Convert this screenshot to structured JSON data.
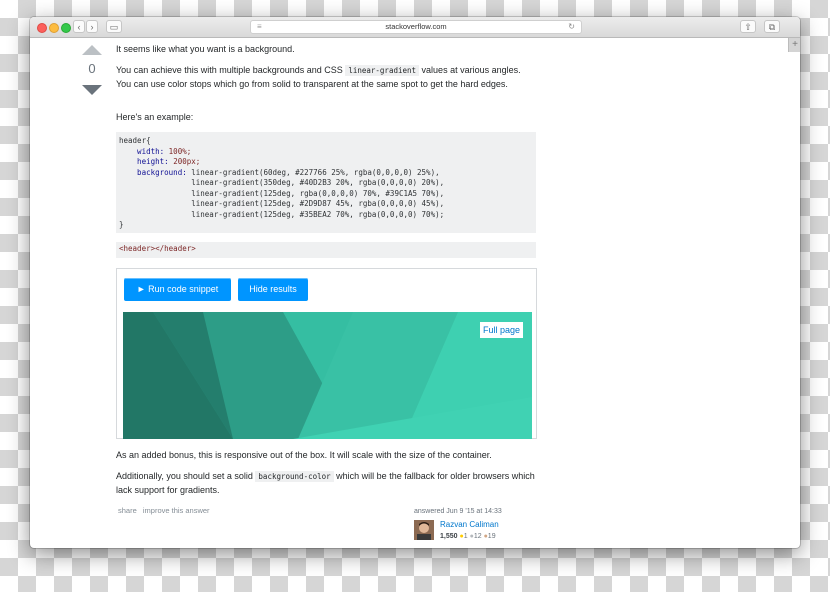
{
  "browser": {
    "url": "stackoverflow.com",
    "back_icon": "‹",
    "forward_icon": "›",
    "sidebar_icon": "▭",
    "lines_icon": "≡",
    "reload_icon": "↻",
    "share_icon": "⇧",
    "tabs_icon": "⧉",
    "new_tab_icon": "+"
  },
  "vote": {
    "score": "0"
  },
  "answer": {
    "p1": "It seems like what you want is a background.",
    "p2_before": "You can achieve this with multiple backgrounds and CSS ",
    "p2_code": "linear-gradient",
    "p2_after": " values at various angles. You can use color stops which go from solid to transparent at the same spot to get the hard edges.",
    "p3": "Here's an example:",
    "code_lines": [
      {
        "a": "header{",
        "b": ""
      },
      {
        "a": "    width: ",
        "b": "100%;",
        "kw": true
      },
      {
        "a": "    height: ",
        "b": "200px;",
        "kw": true
      },
      {
        "a": "    background: ",
        "b": "linear-gradient(60deg, #227766 25%, rgba(0,0,0,0) 25%),",
        "kw": true
      },
      {
        "a": "                ",
        "b": "linear-gradient(350deg, #40D2B3 20%, rgba(0,0,0,0) 20%),"
      },
      {
        "a": "                ",
        "b": "linear-gradient(125deg, rgba(0,0,0,0) 70%, #39C1A5 70%),"
      },
      {
        "a": "                ",
        "b": "linear-gradient(125deg, #2D9D87 45%, rgba(0,0,0,0) 45%),"
      },
      {
        "a": "                ",
        "b": "linear-gradient(125deg, #35BEA2 70%, rgba(0,0,0,0) 70%);"
      },
      {
        "a": "}",
        "b": ""
      }
    ],
    "html_code": "<header></header>",
    "run_button": "► Run code snippet",
    "hide_button": "Hide results",
    "full_page": "Full page",
    "p4": "As an added bonus, this is responsive out of the box. It will scale with the size of the container.",
    "p5_before": "Additionally, you should set a solid ",
    "p5_code": "background-color",
    "p5_after": " which will be the fallback for older browsers which lack support for gradients.",
    "share": "share",
    "improve": "improve this answer"
  },
  "user": {
    "answered": "answered Jun 9 '15 at 14:33",
    "name": "Razvan Caliman",
    "reputation": "1,550",
    "gold": "1",
    "silver": "12",
    "bronze": "19"
  },
  "colors": {
    "accent": "#0095ff",
    "link": "#0077cc",
    "gradient_dark": "#227766",
    "gradient_light": "#40D2B3",
    "gradient_mid": "#39C1A5",
    "gradient_mid2": "#2D9D87",
    "gradient_base": "#35BEA2"
  }
}
